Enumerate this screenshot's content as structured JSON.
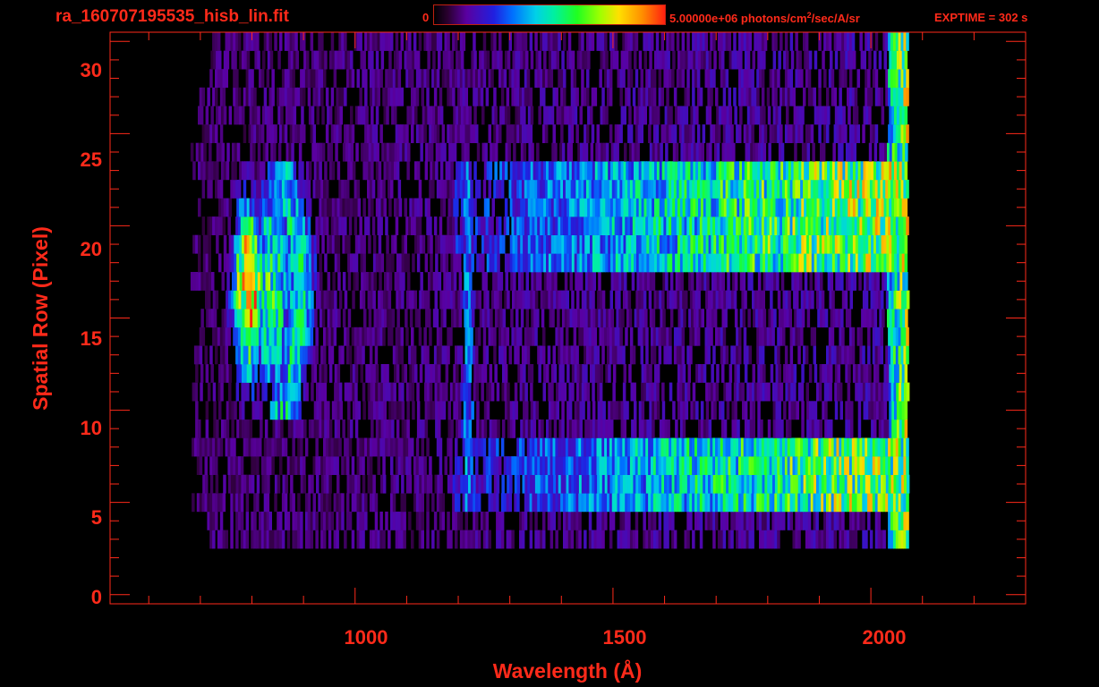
{
  "header": {
    "filename": "ra_160707195535_hisb_lin.fit",
    "colorbar_min": "0",
    "colorbar_max_prefix": "5.00000e+06 photons/cm",
    "colorbar_max_sup": "2",
    "colorbar_max_suffix": "/sec/A/sr",
    "exptime": "EXPTIME = 302 s"
  },
  "colors": {
    "axis": "#ff2a1a",
    "background": "#000000"
  },
  "chart_data": {
    "type": "heatmap",
    "title": "",
    "xlabel": "Wavelength (Å)",
    "ylabel": "Spatial Row (Pixel)",
    "xlim": [
      525,
      2300
    ],
    "ylim": [
      -0.5,
      30.5
    ],
    "x_ticks": [
      1000,
      1500,
      2000
    ],
    "y_ticks": [
      0,
      5,
      10,
      15,
      20,
      25,
      30
    ],
    "colorbar_range": [
      0,
      5000000
    ],
    "colorbar_unit": "photons/cm^2/sec/A/sr",
    "colormap": "rainbow",
    "data_extent": {
      "x": [
        680,
        2070
      ],
      "rows": [
        3,
        30
      ]
    },
    "features": [
      {
        "name": "intense emission",
        "x_range": [
          760,
          880
        ],
        "rows": [
          10,
          23
        ],
        "peak_x": 790,
        "peak_rows": [
          13,
          20
        ],
        "level": "max"
      },
      {
        "name": "Lyman-alpha band",
        "x_center": 1216,
        "rows": [
          5,
          23
        ],
        "level": "medium"
      },
      {
        "name": "upper continuum band",
        "x_range": [
          1200,
          2060
        ],
        "rows": [
          18,
          23
        ],
        "level": "rising to high"
      },
      {
        "name": "lower continuum band",
        "x_range": [
          1190,
          2060
        ],
        "rows": [
          5,
          8
        ],
        "level": "rising to high"
      },
      {
        "name": "detector edge",
        "x_center": 2065,
        "rows": [
          1,
          30
        ],
        "level": "high"
      }
    ]
  }
}
